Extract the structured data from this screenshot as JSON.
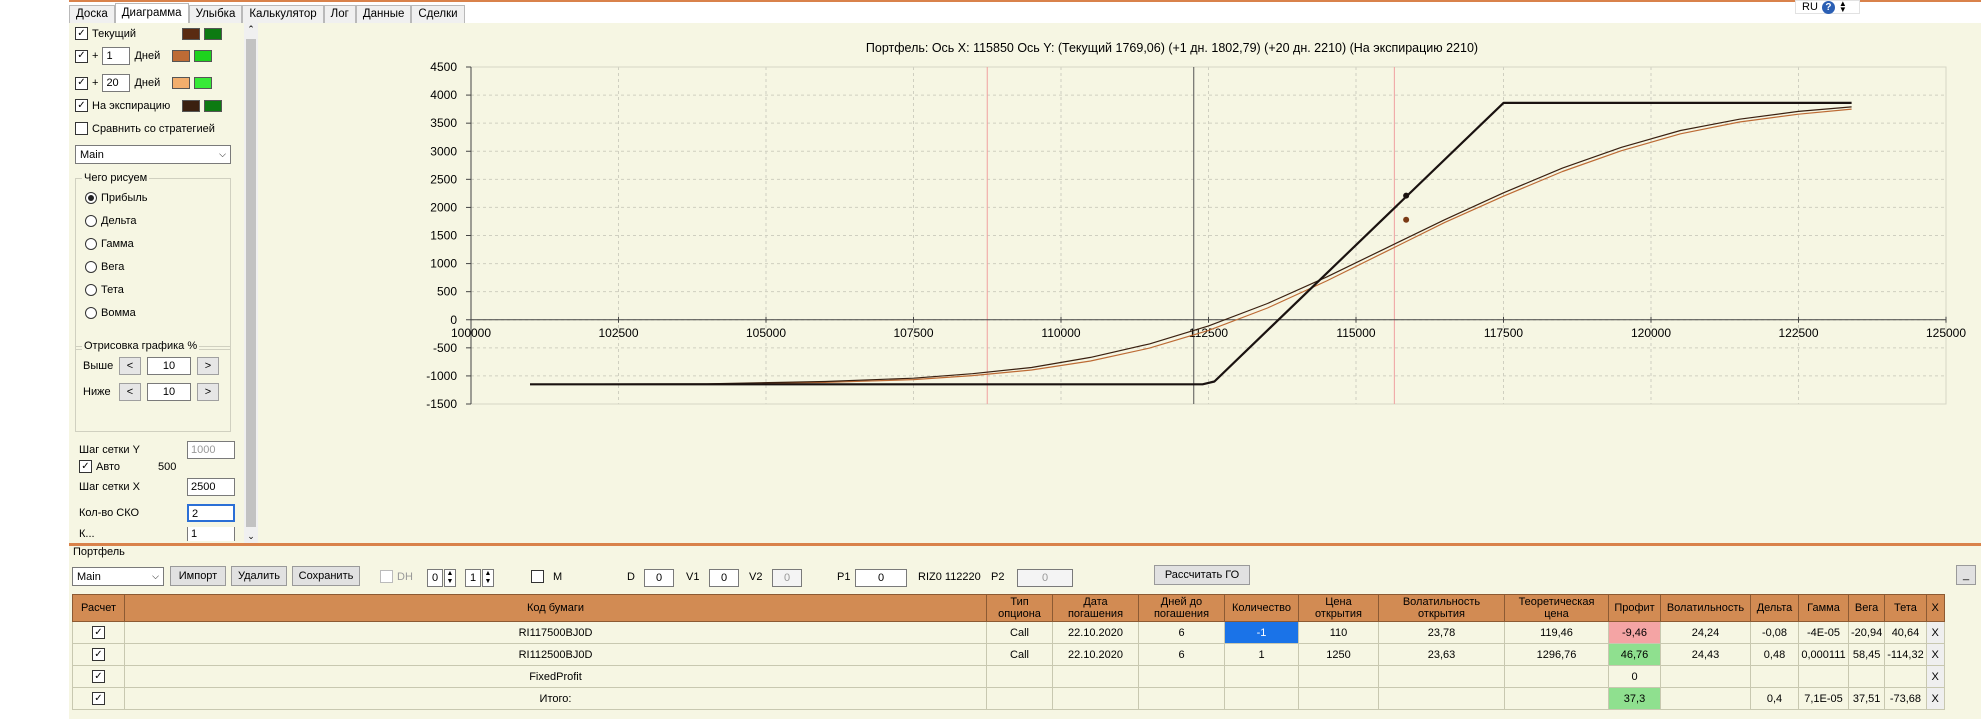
{
  "lang": {
    "code": "RU",
    "help": "?"
  },
  "tabs": [
    {
      "label": "Доска"
    },
    {
      "label": "Диаграмма"
    },
    {
      "label": "Улыбка"
    },
    {
      "label": "Калькулятор"
    },
    {
      "label": "Лог"
    },
    {
      "label": "Данные"
    },
    {
      "label": "Сделки"
    }
  ],
  "left_panel": {
    "curves": {
      "current_label": "Текущий",
      "plus": "+",
      "days_label": "Дней",
      "days1": "1",
      "days2": "20",
      "expiry_label": "На экспирацию",
      "compare_label": "Сравнить со стратегией",
      "strategy": "Main"
    },
    "draw_group": {
      "title": "Чего рисуем",
      "options": [
        "Прибыль",
        "Дельта",
        "Гамма",
        "Вега",
        "Тета",
        "Вомма"
      ],
      "selected": "Прибыль"
    },
    "render_group": {
      "title": "Отрисовка графика %",
      "above_label": "Выше",
      "below_label": "Ниже",
      "above_value": "10",
      "below_value": "10",
      "left_btn": "<",
      "right_btn": ">"
    },
    "grid": {
      "y_step_label": "Шаг сетки Y",
      "y_step_value": "1000",
      "auto_label": "Авто",
      "auto_value": "500",
      "x_step_label": "Шаг сетки X",
      "x_step_value": "2500",
      "sko_label": "Кол-во СКО",
      "sko_value": "2",
      "cut_label": "К...",
      "cut_value": "1"
    }
  },
  "colors": {
    "current_a": "#5a2b12",
    "current_b": "#0d7a12",
    "d1_a": "#bd6b35",
    "d1_b": "#1ed21e",
    "d20_a": "#f2ae6d",
    "d20_b": "#37ea37",
    "exp_a": "#3a2010",
    "exp_b": "#0d7a12",
    "accent": "#d9824b"
  },
  "chart_data": {
    "type": "line",
    "title": "Портфель: Ось X: 115850 Ось Y:  (Текущий 1769,06)  (+1 дн. 1802,79)  (+20  дн. 2210)  (На экспирацию 2210)",
    "xlim": [
      100000,
      125000
    ],
    "ylim": [
      -1500,
      4500
    ],
    "xticks": [
      100000,
      102500,
      105000,
      107500,
      110000,
      112500,
      115000,
      117500,
      120000,
      122500,
      125000
    ],
    "yticks": [
      4500,
      4000,
      3500,
      3000,
      2500,
      2000,
      1500,
      1000,
      500,
      0,
      -500,
      -1000,
      -1500
    ],
    "grid": true,
    "cursor_x": 112250,
    "sigma_lines_x": [
      108750,
      115650
    ],
    "series": [
      {
        "key": "expiry",
        "color": "#1a1210",
        "width": 2.2,
        "x": [
          101000,
          112400,
          112600,
          117500,
          123400
        ],
        "y": [
          -1150,
          -1150,
          -1100,
          3860,
          3860
        ]
      },
      {
        "key": "current",
        "color": "#3a2010",
        "width": 1.2,
        "x": [
          101000,
          104000,
          106000,
          107500,
          108500,
          109500,
          110500,
          111500,
          112500,
          113500,
          114500,
          115500,
          116500,
          117500,
          118500,
          119500,
          120500,
          121500,
          122500,
          123400
        ],
        "y": [
          -1150,
          -1140,
          -1100,
          -1040,
          -960,
          -850,
          -670,
          -430,
          -110,
          290,
          760,
          1270,
          1780,
          2260,
          2700,
          3070,
          3370,
          3570,
          3710,
          3790
        ]
      },
      {
        "key": "plus1",
        "color": "#bd6b35",
        "width": 1.2,
        "x": [
          101000,
          104000,
          106000,
          107500,
          108500,
          109500,
          110500,
          111500,
          112500,
          113500,
          114500,
          115500,
          116500,
          117500,
          118500,
          119500,
          120500,
          121500,
          122500,
          123400
        ],
        "y": [
          -1150,
          -1145,
          -1115,
          -1065,
          -995,
          -895,
          -735,
          -505,
          -190,
          210,
          690,
          1210,
          1730,
          2200,
          2640,
          3010,
          3310,
          3520,
          3660,
          3750
        ]
      }
    ],
    "markers": [
      {
        "x": 115850,
        "y": 2210,
        "color": "#1a1210"
      },
      {
        "x": 115850,
        "y": 1780,
        "color": "#7a3a15"
      }
    ]
  },
  "lower": {
    "title": "Портфель",
    "strategy": "Main",
    "btn_import": "Импорт",
    "btn_delete": "Удалить",
    "btn_save": "Сохранить",
    "dh_label": "DH",
    "dh_a": "0",
    "dh_b": "1",
    "m_label": "M",
    "d_label": "D",
    "d_value": "0",
    "v1_label": "V1",
    "v1_value": "0",
    "v2_label": "V2",
    "v2_value": "0",
    "p1_label": "P1",
    "p1_value": "0",
    "riz_label": "RIZ0 112220",
    "p2_label": "P2",
    "p2_value": "0",
    "btn_go": "Рассчитать ГО",
    "btn_min": "_",
    "table": {
      "headers": [
        "Расчет",
        "Код бумаги",
        "Тип опциона",
        "Дата погашения",
        "Дней до погашения",
        "Количество",
        "Цена открытия",
        "Волатильность открытия",
        "Теоретическая цена",
        "Профит",
        "Волатильность",
        "Дельта",
        "Гамма",
        "Вега",
        "Тета",
        "X"
      ],
      "rows": [
        {
          "code": "RI117500BJ0D",
          "type": "Call",
          "date": "22.10.2020",
          "days": "6",
          "qty": "-1",
          "price": "110",
          "vol_open": "23,78",
          "theo": "119,46",
          "profit": "-9,46",
          "vol": "24,24",
          "delta": "-0,08",
          "gamma": "-4E-05",
          "vega": "-20,94",
          "theta": "40,64",
          "x": "X"
        },
        {
          "code": "RI112500BJ0D",
          "type": "Call",
          "date": "22.10.2020",
          "days": "6",
          "qty": "1",
          "price": "1250",
          "vol_open": "23,63",
          "theo": "1296,76",
          "profit": "46,76",
          "vol": "24,43",
          "delta": "0,48",
          "gamma": "0,000111",
          "vega": "58,45",
          "theta": "-114,32",
          "x": "X"
        },
        {
          "code": "FixedProfit",
          "type": "",
          "date": "",
          "days": "",
          "qty": "",
          "price": "",
          "vol_open": "",
          "theo": "",
          "profit": "0",
          "vol": "",
          "delta": "",
          "gamma": "",
          "vega": "",
          "theta": "",
          "x": "X"
        },
        {
          "code": "Итого:",
          "type": "",
          "date": "",
          "days": "",
          "qty": "",
          "price": "",
          "vol_open": "",
          "theo": "",
          "profit": "37,3",
          "vol": "",
          "delta": "0,4",
          "gamma": "7,1E-05",
          "vega": "37,51",
          "theta": "-73,68",
          "x": "X"
        }
      ]
    }
  }
}
